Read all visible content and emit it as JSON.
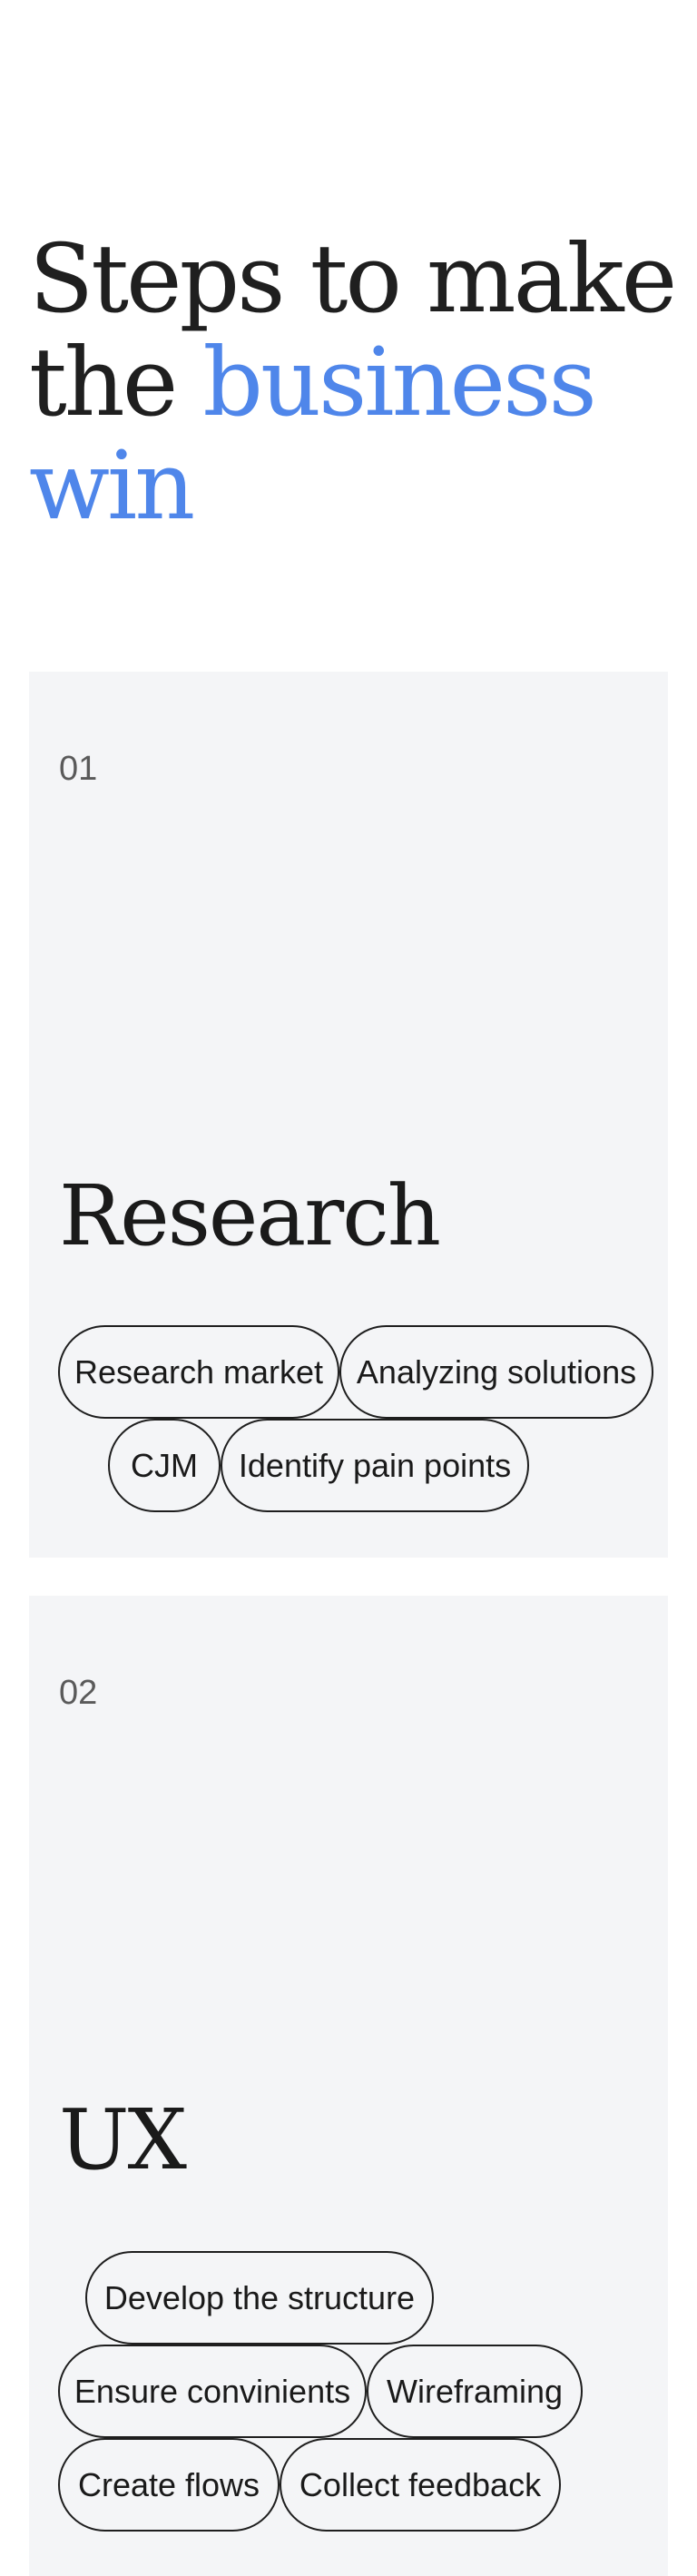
{
  "heading": {
    "line1": "Steps to make",
    "line2_plain": "the ",
    "line2_accent": "business",
    "line3_accent": "win"
  },
  "steps": [
    {
      "number": "01",
      "title": "Research",
      "tags": [
        "Research market",
        "Analyzing solutions",
        "CJM",
        "Identify pain points"
      ]
    },
    {
      "number": "02",
      "title": "UX",
      "tags": [
        "Develop the structure",
        "Ensure convinients",
        "Wireframing",
        "Create flows",
        "Collect feedback"
      ]
    }
  ],
  "colors": {
    "accent": "#4f86ea",
    "card_bg": "#f4f5f7",
    "text": "#1c1c1c"
  }
}
